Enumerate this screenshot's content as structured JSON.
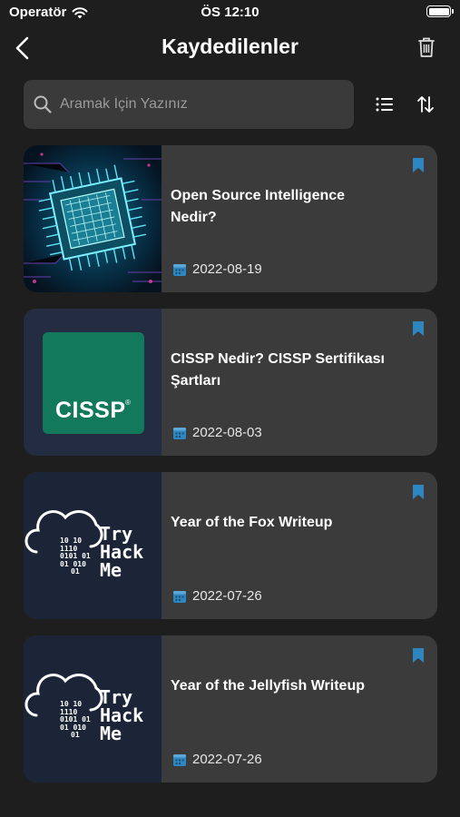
{
  "status": {
    "carrier": "Operatör",
    "time": "ÖS 12:10"
  },
  "nav": {
    "title": "Kaydedilenler"
  },
  "search": {
    "placeholder": "Aramak İçin Yazınız"
  },
  "thumbs": {
    "cissp_logo_text": "CISSP",
    "thm_brand_lines": [
      "Try",
      "Hack",
      "Me"
    ],
    "thm_binary_lines": [
      "10 10",
      "1110",
      "0101 01",
      "01 010",
      "01"
    ]
  },
  "articles": [
    {
      "title": "Open Source Intelligence Nedir?",
      "date": "2022-08-19",
      "thumbnail": "circuit-chip"
    },
    {
      "title": "CISSP Nedir? CISSP Sertifikası Şartları",
      "date": "2022-08-03",
      "thumbnail": "cissp-logo"
    },
    {
      "title": "Year of the Fox Writeup",
      "date": "2022-07-26",
      "thumbnail": "tryhackme-logo"
    },
    {
      "title": "Year of the Jellyfish Writeup",
      "date": "2022-07-26",
      "thumbnail": "tryhackme-logo"
    }
  ],
  "colors": {
    "background": "#1e1e1e",
    "card": "#3b3b3b",
    "accent_blue": "#2e86c1",
    "cissp_green": "#12795a",
    "thm_navy": "#1c2538"
  },
  "icons": {
    "back": "chevron-left-icon",
    "trash": "trash-icon",
    "search": "search-icon",
    "list": "list-icon",
    "sort": "sort-arrows-icon",
    "bookmark": "bookmark-icon",
    "calendar": "calendar-icon"
  }
}
